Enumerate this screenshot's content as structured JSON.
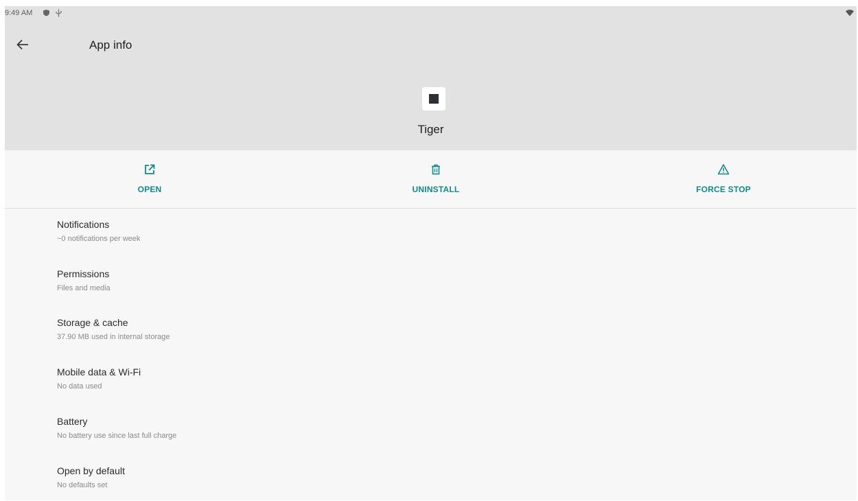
{
  "status_bar": {
    "time": "9:49 AM"
  },
  "header": {
    "title": "App info"
  },
  "app": {
    "name": "Tiger"
  },
  "actions": {
    "open": "OPEN",
    "uninstall": "UNINSTALL",
    "force_stop": "FORCE STOP"
  },
  "settings": {
    "items": [
      {
        "title": "Notifications",
        "subtitle": "~0 notifications per week"
      },
      {
        "title": "Permissions",
        "subtitle": "Files and media"
      },
      {
        "title": "Storage & cache",
        "subtitle": "37.90 MB used in internal storage"
      },
      {
        "title": "Mobile data & Wi-Fi",
        "subtitle": "No data used"
      },
      {
        "title": "Battery",
        "subtitle": "No battery use since last full charge"
      },
      {
        "title": "Open by default",
        "subtitle": "No defaults set"
      }
    ]
  },
  "colors": {
    "accent": "#0f8b8d",
    "header_bg": "#e2e2e2",
    "content_bg": "#f7f7f7"
  },
  "icons": {
    "back": "arrow-back-icon",
    "open": "open-external-icon",
    "uninstall": "trash-icon",
    "force_stop": "warning-icon",
    "wifi": "wifi-icon"
  }
}
